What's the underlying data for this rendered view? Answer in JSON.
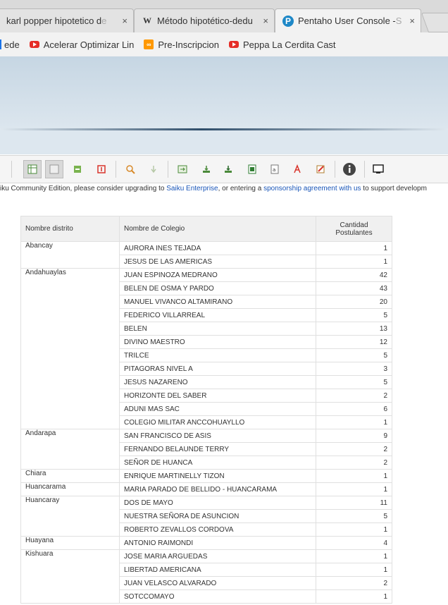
{
  "tabs": [
    {
      "title_visible": "karl popper hipotetico d",
      "title_faded": "e",
      "close": "×"
    },
    {
      "icon": "W",
      "title_visible": "Método hipotético-dedu",
      "title_faded": "",
      "close": "×"
    },
    {
      "icon": "P",
      "title_visible": "Pentaho User Console - ",
      "title_faded": "S",
      "close": "×"
    }
  ],
  "bookmarks": [
    {
      "label": "ede",
      "faded": ""
    },
    {
      "label": "Acelerar Optimizar Lin",
      "faded": ""
    },
    {
      "label": "Pre-Inscripcion",
      "faded": ""
    },
    {
      "label": "Peppa La Cerdita Cast",
      "faded": ""
    }
  ],
  "notice": {
    "prefix": "iku Community Edition, please consider upgrading to ",
    "link1": "Saiku Enterprise",
    "middle": ", or entering a ",
    "link2": "sponsorship agreement with us",
    "suffix": " to support developm"
  },
  "table": {
    "headers": {
      "district": "Nombre distrito",
      "school": "Nombre de Colegio",
      "count": "Cantidad Postulantes"
    },
    "groups": [
      {
        "district": "Abancay",
        "rows": [
          {
            "school": "AURORA INES TEJADA",
            "count": "1"
          },
          {
            "school": "JESUS DE LAS AMERICAS",
            "count": "1"
          }
        ]
      },
      {
        "district": "Andahuaylas",
        "rows": [
          {
            "school": "JUAN ESPINOZA MEDRANO",
            "count": "42"
          },
          {
            "school": "BELEN DE OSMA Y PARDO",
            "count": "43"
          },
          {
            "school": "MANUEL VIVANCO ALTAMIRANO",
            "count": "20"
          },
          {
            "school": "FEDERICO VILLARREAL",
            "count": "5"
          },
          {
            "school": "BELEN",
            "count": "13"
          },
          {
            "school": "DIVINO MAESTRO",
            "count": "12"
          },
          {
            "school": "TRILCE",
            "count": "5"
          },
          {
            "school": "PITAGORAS NIVEL A",
            "count": "3"
          },
          {
            "school": "JESUS NAZARENO",
            "count": "5"
          },
          {
            "school": "HORIZONTE DEL SABER",
            "count": "2"
          },
          {
            "school": "ADUNI MAS SAC",
            "count": "6"
          },
          {
            "school": "COLEGIO MILITAR ANCCOHUAYLLO",
            "count": "1"
          }
        ]
      },
      {
        "district": "Andarapa",
        "rows": [
          {
            "school": "SAN FRANCISCO DE ASIS",
            "count": "9"
          },
          {
            "school": "FERNANDO BELAUNDE TERRY",
            "count": "2"
          },
          {
            "school": "SEÑOR DE HUANCA",
            "count": "2"
          }
        ]
      },
      {
        "district": "Chiara",
        "rows": [
          {
            "school": "ENRIQUE MARTINELLY TIZON",
            "count": "1"
          }
        ]
      },
      {
        "district": "Huancarama",
        "rows": [
          {
            "school": "MARIA PARADO DE BELLIDO - HUANCARAMA",
            "count": "1"
          }
        ]
      },
      {
        "district": "Huancaray",
        "rows": [
          {
            "school": "DOS DE MAYO",
            "count": "11"
          },
          {
            "school": "NUESTRA SEÑORA DE ASUNCION",
            "count": "5"
          },
          {
            "school": "ROBERTO ZEVALLOS CORDOVA",
            "count": "1"
          }
        ]
      },
      {
        "district": "Huayana",
        "rows": [
          {
            "school": "ANTONIO RAIMONDI",
            "count": "4"
          }
        ]
      },
      {
        "district": "Kishuara",
        "rows": [
          {
            "school": "JOSE MARIA ARGUEDAS",
            "count": "1"
          },
          {
            "school": "LIBERTAD AMERICANA",
            "count": "1"
          },
          {
            "school": "JUAN VELASCO ALVARADO",
            "count": "2"
          },
          {
            "school": "SOTCCOMAYO",
            "count": "1"
          }
        ]
      }
    ]
  }
}
